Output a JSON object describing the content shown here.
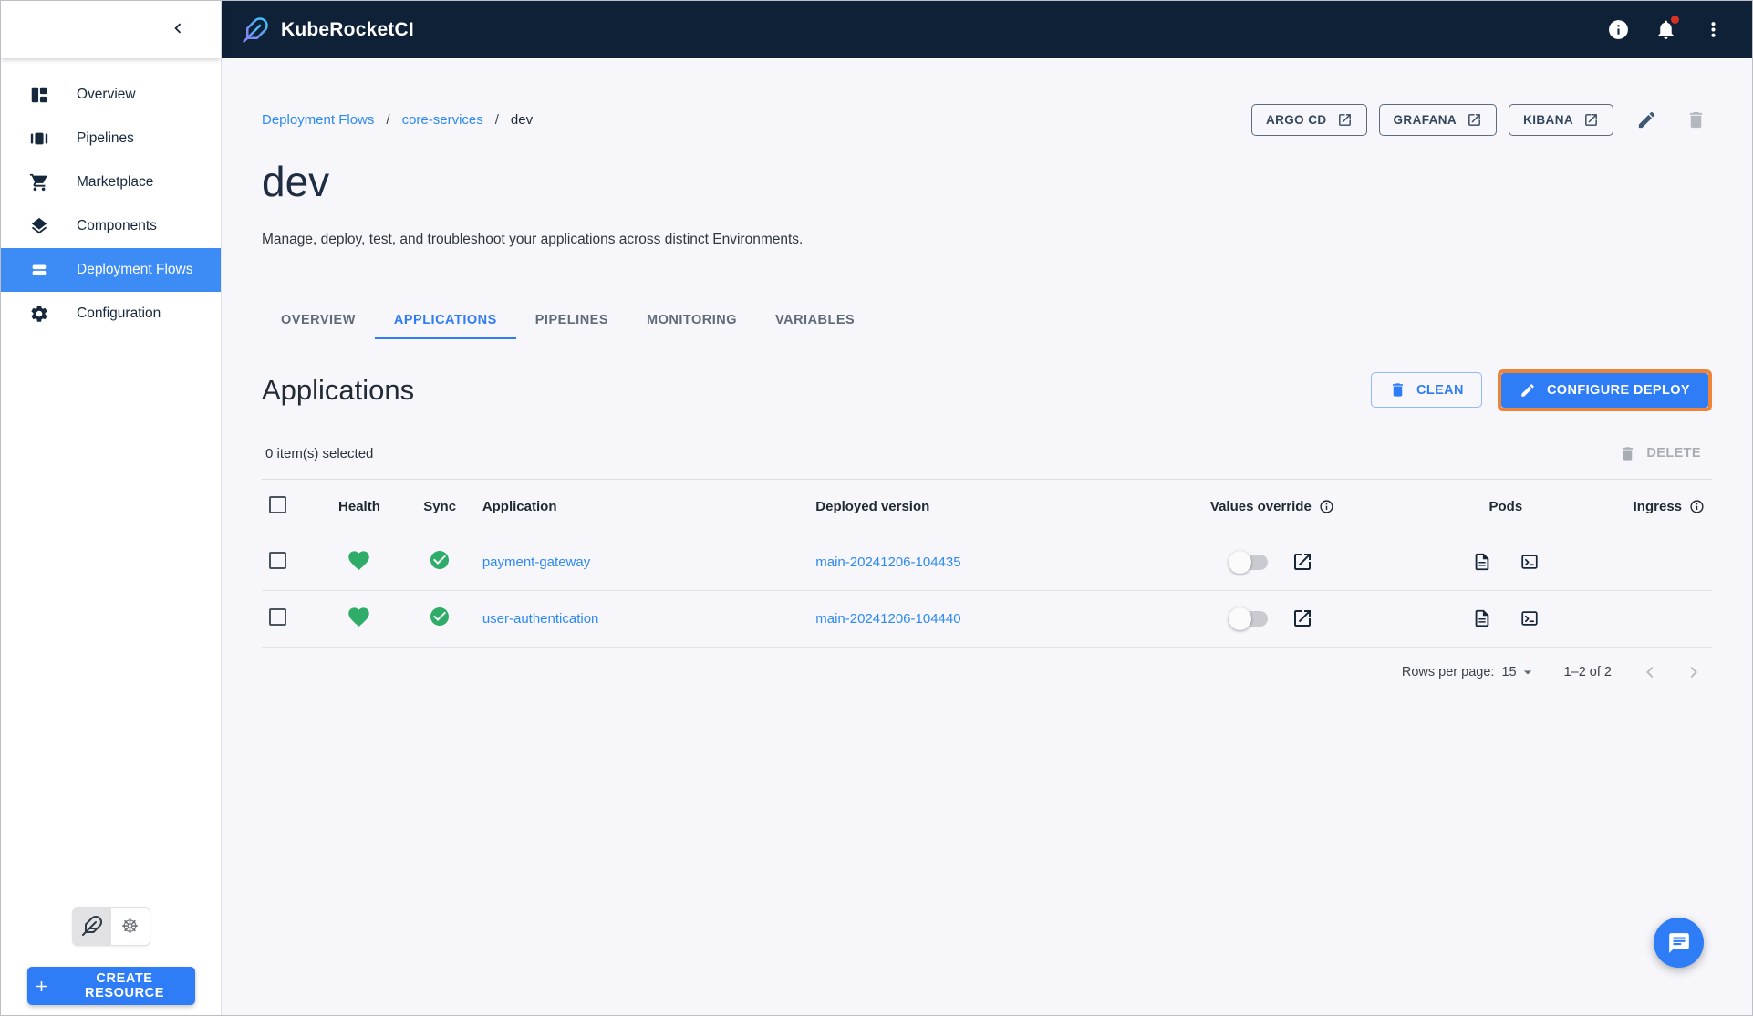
{
  "colors": {
    "header_bg": "#0f2137",
    "sidebar_active_blue": "#3d8bf5",
    "link_blue": "#2e8af0",
    "primary_button_blue": "#2f7cf7",
    "highlight_orange": "#ee8438",
    "success_green": "#2eac68",
    "content_bg": "#f6f6fb",
    "notification_badge_red": "#d93025"
  },
  "header": {
    "title": "KubeRocketCI"
  },
  "sidebar": {
    "items": [
      {
        "label": "Overview",
        "icon": "overview-icon",
        "active": false
      },
      {
        "label": "Pipelines",
        "icon": "pipelines-icon",
        "active": false
      },
      {
        "label": "Marketplace",
        "icon": "marketplace-icon",
        "active": false
      },
      {
        "label": "Components",
        "icon": "components-icon",
        "active": false
      },
      {
        "label": "Deployment Flows",
        "icon": "deployment-flows-icon",
        "active": true
      },
      {
        "label": "Configuration",
        "icon": "configuration-icon",
        "active": false
      }
    ],
    "create_resource_label": "CREATE RESOURCE"
  },
  "breadcrumb": {
    "separator": "/",
    "items": [
      {
        "label": "Deployment Flows",
        "link": true
      },
      {
        "label": "core-services",
        "link": true
      },
      {
        "label": "dev",
        "link": false
      }
    ]
  },
  "page": {
    "title": "dev",
    "description": "Manage, deploy, test, and troubleshoot your applications across distinct Environments.",
    "quick_links": [
      {
        "label": "ARGO CD"
      },
      {
        "label": "GRAFANA"
      },
      {
        "label": "KIBANA"
      }
    ]
  },
  "tabs": {
    "items": [
      {
        "label": "OVERVIEW",
        "active": false
      },
      {
        "label": "APPLICATIONS",
        "active": true
      },
      {
        "label": "PIPELINES",
        "active": false
      },
      {
        "label": "MONITORING",
        "active": false
      },
      {
        "label": "VARIABLES",
        "active": false
      }
    ]
  },
  "applications": {
    "heading": "Applications",
    "clean_button": "CLEAN",
    "configure_deploy_button": "CONFIGURE DEPLOY",
    "selected_count_text": "0 item(s) selected",
    "delete_button": "DELETE",
    "table": {
      "columns": {
        "health": "Health",
        "sync": "Sync",
        "application": "Application",
        "deployed_version": "Deployed version",
        "values_override": "Values override",
        "pods": "Pods",
        "ingress": "Ingress"
      },
      "rows": [
        {
          "application": "payment-gateway",
          "deployed_version": "main-20241206-104435",
          "health": "healthy",
          "sync": "synced",
          "values_override_enabled": false
        },
        {
          "application": "user-authentication",
          "deployed_version": "main-20241206-104440",
          "health": "healthy",
          "sync": "synced",
          "values_override_enabled": false
        }
      ]
    },
    "pagination": {
      "rows_per_page_label": "Rows per page:",
      "rows_per_page_value": "15",
      "range_text": "1–2 of 2"
    }
  }
}
